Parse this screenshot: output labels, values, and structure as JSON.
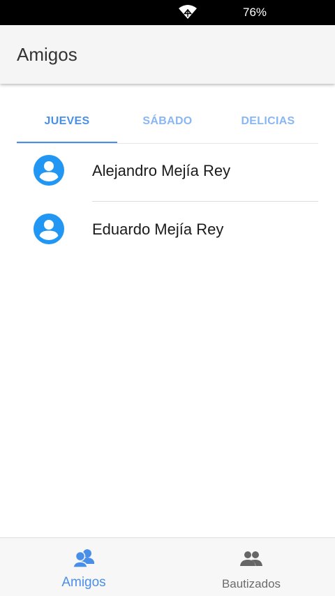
{
  "status_bar": {
    "battery_percent": "76%",
    "wifi_icon": "wifi-icon"
  },
  "app_bar": {
    "title": "Amigos"
  },
  "tabs": [
    {
      "label": "JUEVES",
      "active": true
    },
    {
      "label": "SÁBADO",
      "active": false
    },
    {
      "label": "DELICIAS",
      "active": false
    }
  ],
  "friends": [
    {
      "name": "Alejandro Mejía Rey",
      "icon": "account-circle-icon"
    },
    {
      "name": "Eduardo Mejía Rey",
      "icon": "account-circle-icon"
    }
  ],
  "bottom_nav": [
    {
      "label": "Amigos",
      "icon": "friends-icon",
      "active": true
    },
    {
      "label": "Bautizados",
      "icon": "group-icon",
      "active": false
    }
  ],
  "colors": {
    "accent": "#4a8fe7",
    "avatar": "#2196f3",
    "tab_inactive": "#8ab6f4",
    "app_bar_bg": "#f5f5f5",
    "status_bar_bg": "#000000"
  }
}
